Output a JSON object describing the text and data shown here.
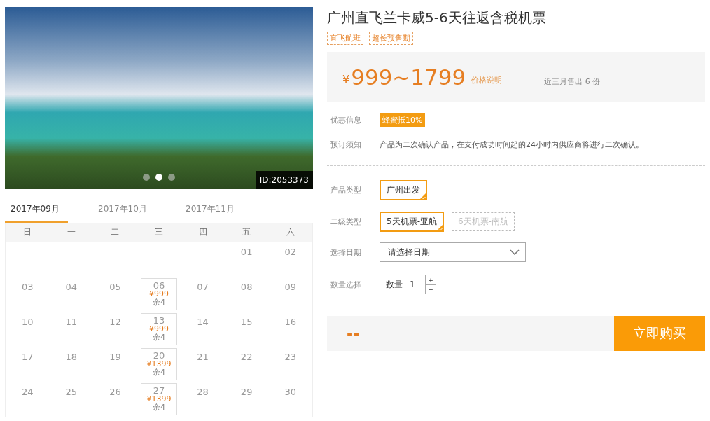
{
  "gallery": {
    "photo_id": "ID:2053373",
    "dots": [
      {
        "selected": false
      },
      {
        "selected": true
      },
      {
        "selected": false
      }
    ]
  },
  "calendar": {
    "tabs": [
      {
        "label": "2017年09月",
        "selected": true
      },
      {
        "label": "2017年10月",
        "selected": false
      },
      {
        "label": "2017年11月",
        "selected": false
      }
    ],
    "weekdays": [
      "日",
      "一",
      "二",
      "三",
      "四",
      "五",
      "六"
    ],
    "weeks": [
      [
        {
          "kind": "blank"
        },
        {
          "kind": "blank"
        },
        {
          "kind": "blank"
        },
        {
          "kind": "blank"
        },
        {
          "kind": "blank"
        },
        {
          "kind": "day",
          "day": "01"
        },
        {
          "kind": "day",
          "day": "02"
        }
      ],
      [
        {
          "kind": "day",
          "day": "03"
        },
        {
          "kind": "day",
          "day": "04"
        },
        {
          "kind": "day",
          "day": "05"
        },
        {
          "kind": "offer",
          "day": "06",
          "price": "¥999",
          "stock": "余4"
        },
        {
          "kind": "day",
          "day": "07"
        },
        {
          "kind": "day",
          "day": "08"
        },
        {
          "kind": "day",
          "day": "09"
        }
      ],
      [
        {
          "kind": "day",
          "day": "10"
        },
        {
          "kind": "day",
          "day": "11"
        },
        {
          "kind": "day",
          "day": "12"
        },
        {
          "kind": "offer",
          "day": "13",
          "price": "¥999",
          "stock": "余4"
        },
        {
          "kind": "day",
          "day": "14"
        },
        {
          "kind": "day",
          "day": "15"
        },
        {
          "kind": "day",
          "day": "16"
        }
      ],
      [
        {
          "kind": "day",
          "day": "17"
        },
        {
          "kind": "day",
          "day": "18"
        },
        {
          "kind": "day",
          "day": "19"
        },
        {
          "kind": "offer",
          "day": "20",
          "price": "¥1399",
          "stock": "余4"
        },
        {
          "kind": "day",
          "day": "21"
        },
        {
          "kind": "day",
          "day": "22"
        },
        {
          "kind": "day",
          "day": "23"
        }
      ],
      [
        {
          "kind": "day",
          "day": "24"
        },
        {
          "kind": "day",
          "day": "25"
        },
        {
          "kind": "day",
          "day": "26"
        },
        {
          "kind": "offer",
          "day": "27",
          "price": "¥1399",
          "stock": "余4"
        },
        {
          "kind": "day",
          "day": "28"
        },
        {
          "kind": "day",
          "day": "29"
        },
        {
          "kind": "day",
          "day": "30"
        }
      ]
    ]
  },
  "product": {
    "title": "广州直飞兰卡威5-6天往返含税机票",
    "tags": [
      "直飞航班",
      "超长预售期"
    ],
    "price": {
      "currency": "¥",
      "range": "999~1799",
      "note": "价格说明",
      "sales": "近三月售出 6 份"
    },
    "discount": {
      "label": "优惠信息",
      "badge": "蜂蜜抵10%"
    },
    "notice": {
      "label": "预订须知",
      "text": "产品为二次确认产品，在支付成功时间起的24小时内供应商将进行二次确认。"
    },
    "option_groups": [
      {
        "label": "产品类型",
        "options": [
          {
            "label": "广州出发",
            "selected": true
          }
        ]
      },
      {
        "label": "二级类型",
        "options": [
          {
            "label": "5天机票-亚航",
            "selected": true
          },
          {
            "label": "6天机票-南航",
            "selected": false
          }
        ]
      }
    ],
    "date": {
      "label": "选择日期",
      "placeholder": "请选择日期"
    },
    "quantity": {
      "label": "数量选择",
      "prefix": "数量",
      "value": "1",
      "plus": "+",
      "minus": "−"
    },
    "total": "--",
    "buy": "立即购买"
  }
}
